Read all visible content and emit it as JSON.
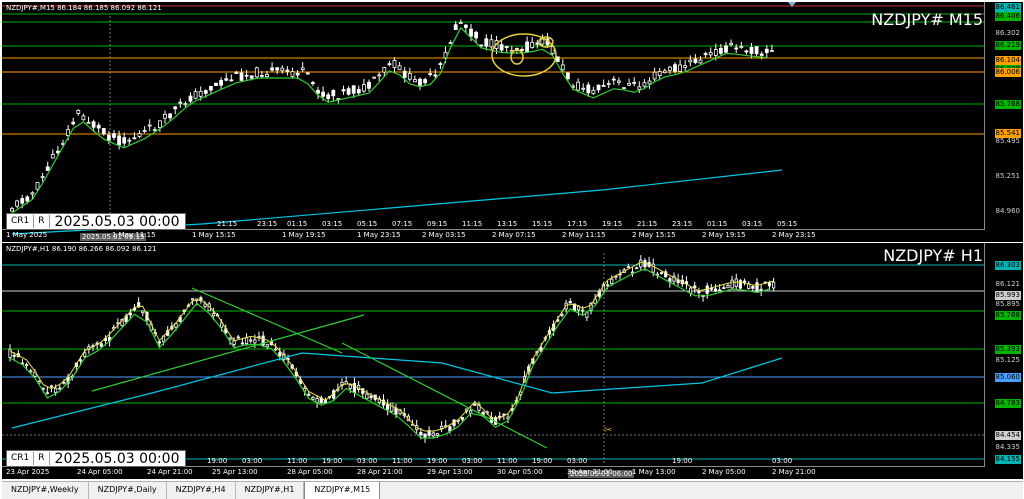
{
  "m15": {
    "header": "NZDJPY#,M15  86.184 86.185 86.092 86.121",
    "big_symbol": "NZDJPY# M15",
    "cursor_date": "2025.05.03 00:00",
    "time_pill": "2025.05.01 09:15",
    "buttons": [
      "CR1",
      "R"
    ],
    "price_labels": [
      {
        "text": "86.461",
        "color": "#00b4b4",
        "boxed": true
      },
      {
        "text": "86.406",
        "color": "#00b400",
        "boxed": true
      },
      {
        "text": "86.302",
        "color": "#cfcfcf",
        "boxed": false
      },
      {
        "text": "86.219",
        "color": "#00b400",
        "boxed": true
      },
      {
        "text": "86.104",
        "color": "#ff9f00",
        "boxed": true
      },
      {
        "text": "86.030",
        "color": "#00b400",
        "boxed": true
      },
      {
        "text": "86.006",
        "color": "#ff9f00",
        "boxed": true
      },
      {
        "text": "85.768",
        "color": "#00b400",
        "boxed": true
      },
      {
        "text": "85.541",
        "color": "#ff9f00",
        "boxed": true
      },
      {
        "text": "85.495",
        "color": "#cfcfcf",
        "boxed": false
      },
      {
        "text": "85.251",
        "color": "#cfcfcf",
        "boxed": false
      },
      {
        "text": "84.960",
        "color": "#cfcfcf",
        "boxed": false
      }
    ],
    "time_labels": [
      "1 May 2025",
      "1 May 11:15",
      "1 May 15:15",
      "1 May 19:15",
      "1 May 23:15",
      "2 May 03:15",
      "2 May 07:15",
      "2 May 11:15",
      "2 May 15:15",
      "2 May 19:15",
      "2 May 23:15"
    ],
    "hour_labels": [
      "21:15",
      "23:15",
      "01:15",
      "03:15",
      "05:15",
      "07:15",
      "09:15",
      "11:15",
      "13:15",
      "15:15",
      "17:15",
      "19:15",
      "21:15",
      "23:15",
      "01:15",
      "03:15",
      "05:15"
    ]
  },
  "h1": {
    "header": "NZDJPY#,H1  86.190 86.266 86.092 86.121",
    "big_symbol": "NZDJPY# H1",
    "cursor_date": "2025.05.03 00:00",
    "time_pill": "2025.05.01 06:00",
    "buttons": [
      "CR1",
      "R"
    ],
    "price_labels": [
      {
        "text": "86.303",
        "color": "#00b4b4",
        "boxed": true
      },
      {
        "text": "86.121",
        "color": "#cfcfcf",
        "boxed": false
      },
      {
        "text": "85.993",
        "color": "#cfcfcf",
        "boxed": true
      },
      {
        "text": "85.895",
        "color": "#cfcfcf",
        "boxed": false
      },
      {
        "text": "85.768",
        "color": "#00b400",
        "boxed": true
      },
      {
        "text": "85.393",
        "color": "#00b400",
        "boxed": true
      },
      {
        "text": "85.060",
        "color": "#4aa0ff",
        "boxed": true
      },
      {
        "text": "85.125",
        "color": "#cfcfcf",
        "boxed": false
      },
      {
        "text": "84.783",
        "color": "#00b400",
        "boxed": true
      },
      {
        "text": "84.454",
        "color": "#cfcfcf",
        "boxed": true
      },
      {
        "text": "84.335",
        "color": "#cfcfcf",
        "boxed": false
      },
      {
        "text": "84.155",
        "color": "#00b4b4",
        "boxed": true
      }
    ],
    "time_labels": [
      "23 Apr 2025",
      "24 Apr 05:00",
      "24 Apr 21:00",
      "25 Apr 13:00",
      "28 Apr 05:00",
      "28 Apr 21:00",
      "29 Apr 13:00",
      "30 Apr 05:00",
      "30 Apr 21:00",
      "1 May 13:00",
      "2 May 05:00",
      "2 May 21:00"
    ],
    "hour_labels": [
      "19:00",
      "03:00",
      "11:00",
      "19:00",
      "03:00",
      "11:00",
      "19:00",
      "03:00",
      "11:00",
      "19:00",
      "03:00",
      "19:00",
      "03:00"
    ]
  },
  "tabs": [
    "NZDJPY#,Weekly",
    "NZDJPY#,Daily",
    "NZDJPY#,H4",
    "NZDJPY#,H1",
    "NZDJPY#,M15"
  ],
  "active_tab": "NZDJPY#,M15",
  "colors": {
    "background": "#000000",
    "bull": "#ffffff",
    "bear": "#ffffff",
    "ma_fast": "#32cd32",
    "ma_slow": "#00c8e6",
    "level_green": "#00b400",
    "level_orange": "#ff9f00",
    "annotation_yellow": "#e6d23c"
  }
}
